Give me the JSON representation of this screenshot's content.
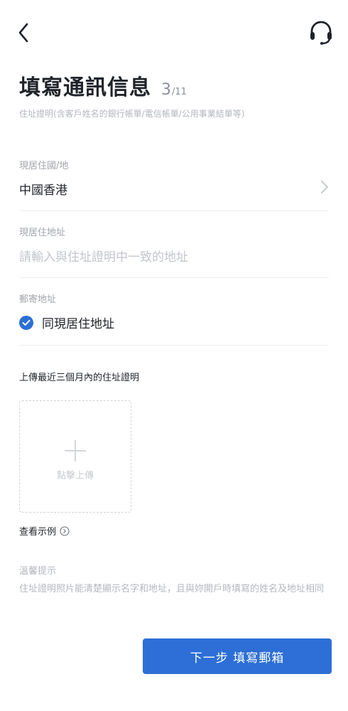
{
  "header": {
    "back_icon": "chevron-left-icon",
    "support_icon": "headset-icon",
    "title": "填寫通訊信息",
    "step_current": "3",
    "step_total": "/11",
    "subtitle": "住址證明(含客戶姓名的銀行帳單/電信帳單/公用事業結單等)"
  },
  "form": {
    "country": {
      "label": "現居住國/地",
      "value": "中國香港",
      "icon": "chevron-right-icon"
    },
    "address": {
      "label": "現居住地址",
      "placeholder": "請輸入與住址證明中一致的地址"
    },
    "mailing": {
      "label": "郵寄地址",
      "option": "同現居住地址",
      "checked": true,
      "icon": "check-icon"
    }
  },
  "upload": {
    "title": "上傳最近三個月內的住址證明",
    "button_text": "點擊上傳",
    "icon": "plus-icon",
    "example_link": "查看示例",
    "example_icon": "play-circle-icon"
  },
  "tips": {
    "title": "溫馨提示",
    "body": "住址證明照片能清楚顯示名字和地址，且與妳開戶時填寫的姓名及地址相同"
  },
  "footer": {
    "next_button": "下一步 填寫郵箱"
  },
  "colors": {
    "primary": "#2d6fd6",
    "text": "#1f2329",
    "muted": "#b3b7bf",
    "divider": "#eceef1"
  }
}
